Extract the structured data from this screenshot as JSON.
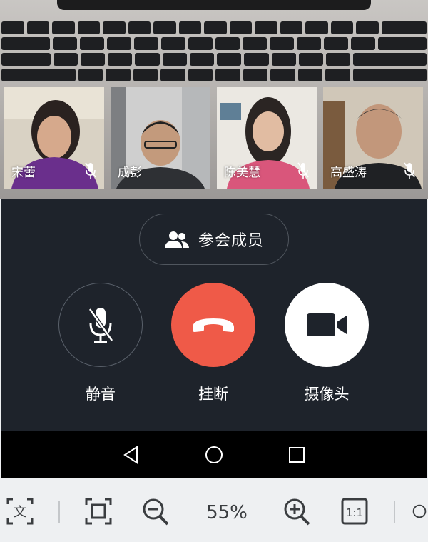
{
  "participants": [
    {
      "name": "宋蕾",
      "mic_muted": true
    },
    {
      "name": "成彭",
      "mic_muted": false
    },
    {
      "name": "陈美慧",
      "mic_muted": true
    },
    {
      "name": "高盛涛",
      "mic_muted": true
    }
  ],
  "members_button": {
    "label": "参会成员",
    "icon": "people-icon"
  },
  "controls": [
    {
      "label": "静音",
      "icon": "mic-off-icon"
    },
    {
      "label": "挂断",
      "icon": "phone-hangup-icon",
      "color": "#ef5a48"
    },
    {
      "label": "摄像头",
      "icon": "video-camera-icon"
    }
  ],
  "nav": [
    "back-icon",
    "home-icon",
    "recents-icon"
  ],
  "toolbar": {
    "zoom": "55%"
  }
}
